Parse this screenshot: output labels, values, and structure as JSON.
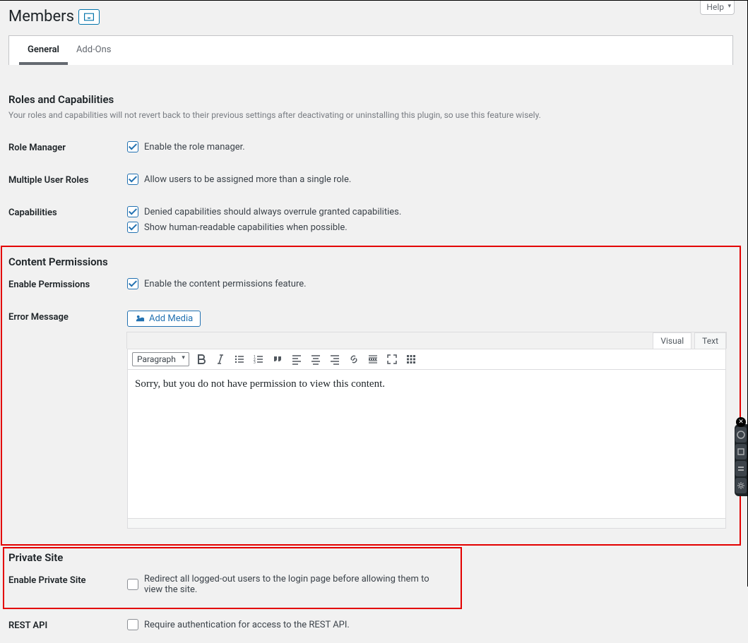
{
  "help_label": "Help",
  "page_title": "Members",
  "tabs": {
    "general": "General",
    "addons": "Add-Ons"
  },
  "sections": {
    "roles_caps": {
      "heading": "Roles and Capabilities",
      "desc": "Your roles and capabilities will not revert back to their previous settings after deactivating or uninstalling this plugin, so use this feature wisely.",
      "fields": {
        "role_manager": {
          "label": "Role Manager",
          "cb": "Enable the role manager.",
          "checked": true
        },
        "multi_roles": {
          "label": "Multiple User Roles",
          "cb": "Allow users to be assigned more than a single role.",
          "checked": true
        },
        "capabilities": {
          "label": "Capabilities",
          "cb1": "Denied capabilities should always overrule granted capabilities.",
          "cb2": "Show human-readable capabilities when possible.",
          "checked1": true,
          "checked2": true
        }
      }
    },
    "content_perms": {
      "heading": "Content Permissions",
      "fields": {
        "enable": {
          "label": "Enable Permissions",
          "cb": "Enable the content permissions feature.",
          "checked": true
        },
        "error_msg": {
          "label": "Error Message",
          "add_media": "Add Media",
          "editor_tabs": {
            "visual": "Visual",
            "text": "Text"
          },
          "format": "Paragraph",
          "body": "Sorry, but you do not have permission to view this content."
        }
      }
    },
    "private_site": {
      "heading": "Private Site",
      "fields": {
        "enable": {
          "label": "Enable Private Site",
          "cb": "Redirect all logged-out users to the login page before allowing them to view the site.",
          "checked": false
        },
        "rest_api": {
          "label": "REST API",
          "cb": "Require authentication for access to the REST API.",
          "checked": false
        }
      }
    }
  }
}
